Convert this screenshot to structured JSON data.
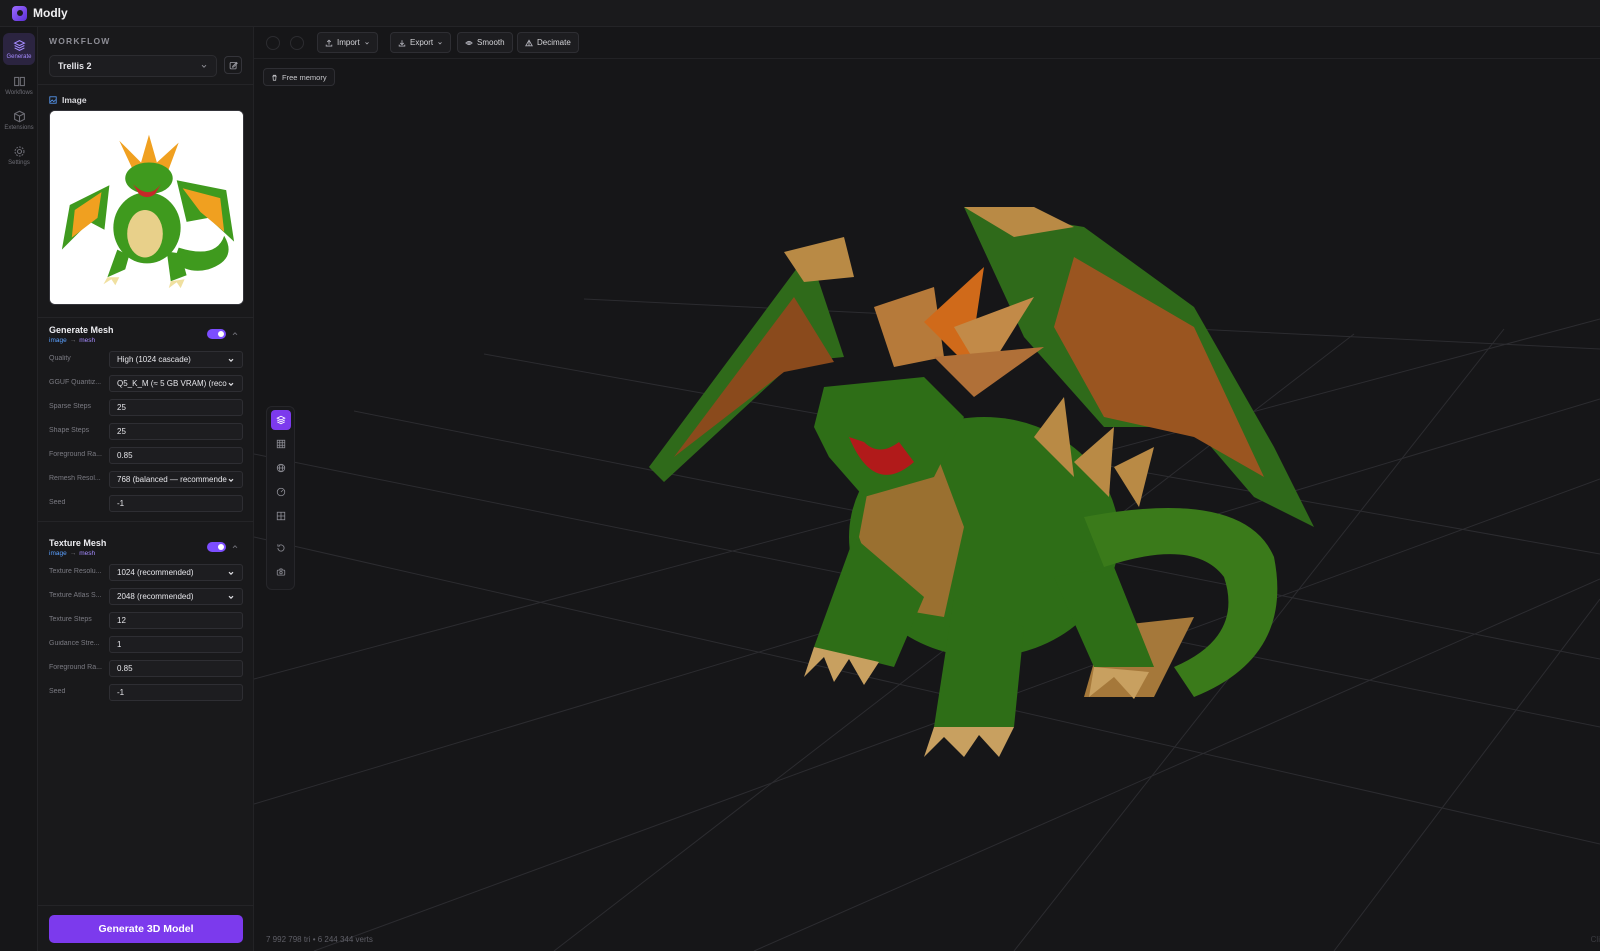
{
  "app": {
    "title": "Modly"
  },
  "rail": [
    {
      "label": "Generate",
      "icon": "layers-icon",
      "active": true
    },
    {
      "label": "Workflows",
      "icon": "columns-icon",
      "active": false
    },
    {
      "label": "Extensions",
      "icon": "cube-icon",
      "active": false
    },
    {
      "label": "Settings",
      "icon": "gear-icon",
      "active": false
    }
  ],
  "panel": {
    "section_label": "WORKFLOW",
    "workflow_selected": "Trellis 2",
    "image_label": "Image",
    "generate_mesh": {
      "title": "Generate Mesh",
      "flow_in": "image",
      "flow_arrow": "→",
      "flow_out": "mesh",
      "enabled": true,
      "params": [
        {
          "label": "Quality",
          "value": "High (1024 cascade)",
          "type": "select"
        },
        {
          "label": "GGUF Quantiz...",
          "value": "Q5_K_M (≈ 5 GB VRAM) (recor",
          "type": "select"
        },
        {
          "label": "Sparse Steps",
          "value": "25",
          "type": "input"
        },
        {
          "label": "Shape Steps",
          "value": "25",
          "type": "input"
        },
        {
          "label": "Foreground Ra...",
          "value": "0.85",
          "type": "input"
        },
        {
          "label": "Remesh Resol...",
          "value": "768 (balanced — recommende",
          "type": "select"
        },
        {
          "label": "Seed",
          "value": "-1",
          "type": "input"
        }
      ]
    },
    "texture_mesh": {
      "title": "Texture Mesh",
      "flow_in": "image",
      "flow_arrow": "→",
      "flow_out": "mesh",
      "enabled": true,
      "params": [
        {
          "label": "Texture Resolu...",
          "value": "1024 (recommended)",
          "type": "select"
        },
        {
          "label": "Texture Atlas S...",
          "value": "2048 (recommended)",
          "type": "select"
        },
        {
          "label": "Texture Steps",
          "value": "12",
          "type": "input"
        },
        {
          "label": "Guidance Stre...",
          "value": "1",
          "type": "input"
        },
        {
          "label": "Foreground Ra...",
          "value": "0.85",
          "type": "input"
        },
        {
          "label": "Seed",
          "value": "-1",
          "type": "input"
        }
      ]
    },
    "generate_button": "Generate 3D Model"
  },
  "toolbar": {
    "import_label": "Import",
    "export_label": "Export",
    "smooth_label": "Smooth",
    "decimate_label": "Decimate",
    "free_memory_label": "Free memory"
  },
  "viewport": {
    "stats": "7 992 798 tri • 6 244 344 verts",
    "corner_hint": "Cli",
    "tools": [
      "mesh-view-icon",
      "wireframe-icon",
      "globe-icon",
      "gauge-icon",
      "uv-grid-icon",
      "reset-view-icon",
      "camera-icon"
    ],
    "accent": "#7c3aed"
  }
}
